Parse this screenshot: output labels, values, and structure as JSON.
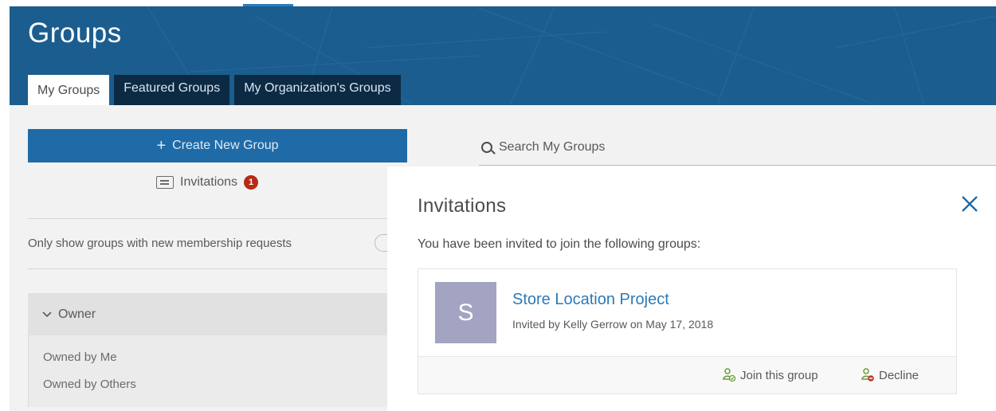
{
  "header": {
    "title": "Groups",
    "tabs": [
      {
        "label": "My Groups",
        "active": true
      },
      {
        "label": "Featured Groups",
        "active": false
      },
      {
        "label": "My Organization's Groups",
        "active": false
      }
    ]
  },
  "sidebar": {
    "create_button_label": "Create New Group",
    "invitations_label": "Invitations",
    "invitations_count": "1",
    "membership_toggle_label": "Only show groups with new membership requests",
    "owner_filter": {
      "label": "Owner",
      "options": [
        "Owned by Me",
        "Owned by Others"
      ]
    }
  },
  "search": {
    "placeholder": "Search My Groups"
  },
  "modal": {
    "title": "Invitations",
    "intro": "You have been invited to join the following groups:",
    "invitations": [
      {
        "avatar_letter": "S",
        "group_name": "Store Location Project",
        "invited_by": "Invited by Kelly Gerrow on May 17, 2018",
        "join_label": "Join this group",
        "decline_label": "Decline"
      }
    ]
  },
  "colors": {
    "banner": "#1b5d8e",
    "accent_blue": "#1f6ba8",
    "link_blue": "#2d7ab8",
    "badge_red": "#b72a17",
    "avatar": "#a3a3c2"
  }
}
